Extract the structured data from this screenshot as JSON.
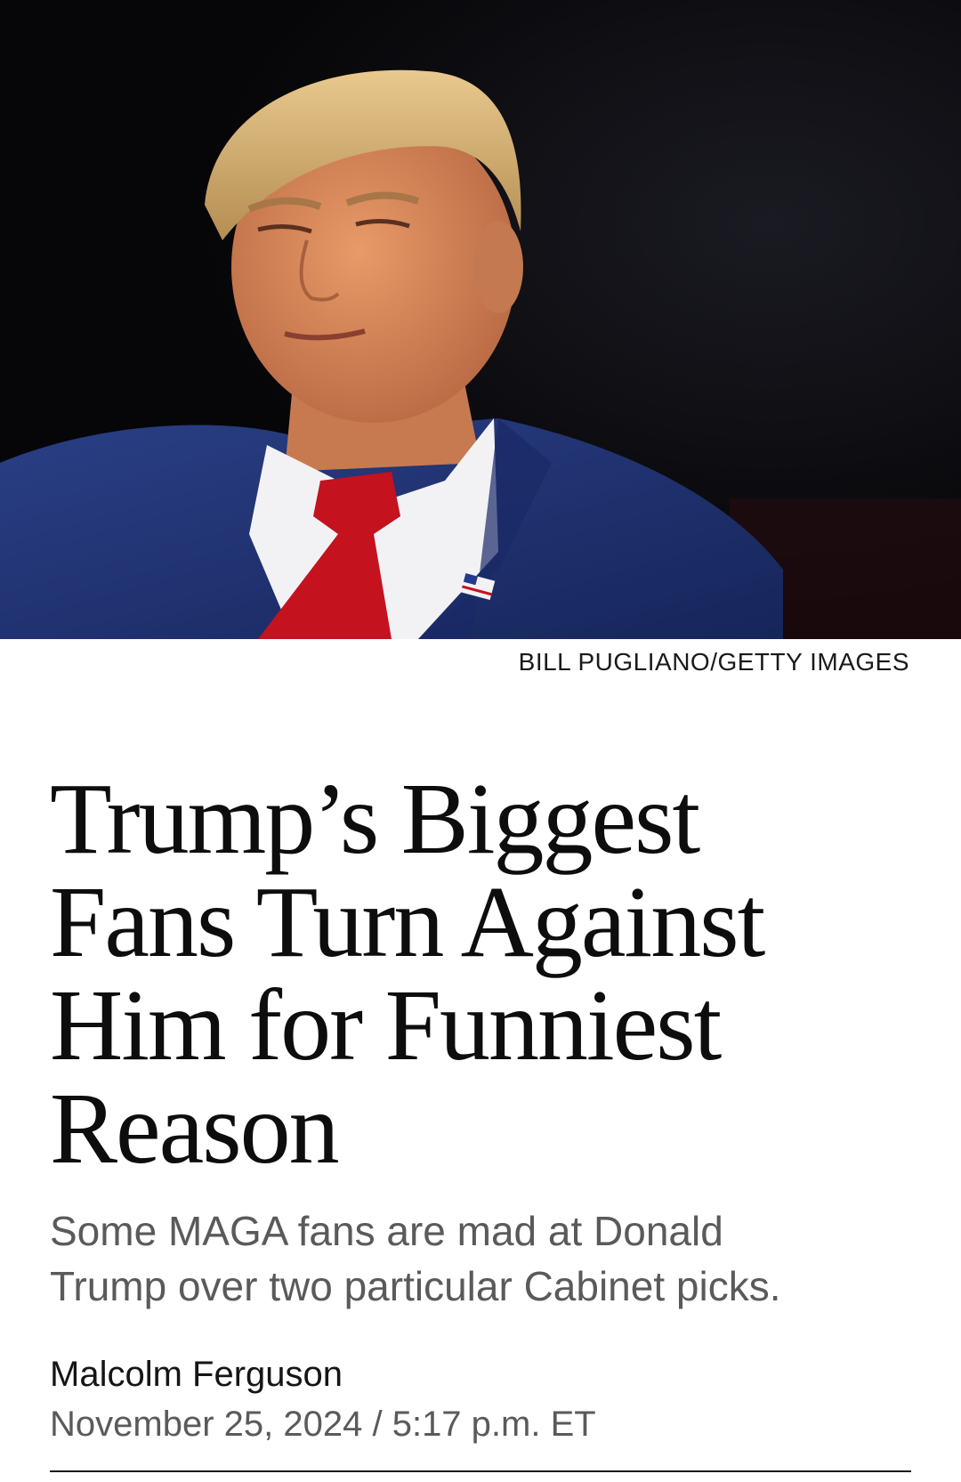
{
  "article": {
    "photo_credit": "BILL PUGLIANO/GETTY IMAGES",
    "headline_lines": [
      "Trump’s Biggest",
      "Fans Turn Against",
      "Him for Funniest",
      "Reason"
    ],
    "dek_lines": [
      "Some MAGA fans are mad at Donald",
      "Trump over two particular Cabinet picks."
    ],
    "author": "Malcolm Ferguson",
    "date": "November 25, 2024",
    "date_separator": "/",
    "time": "5:17 p.m. ET"
  },
  "hero_image": {
    "subject": "portrait-photo",
    "colors": {
      "background": "#0b0b10",
      "suit": "#1f3372",
      "tie": "#c4121f",
      "shirt": "#f2f2f4",
      "skin": "#d98a5c",
      "hair": "#d8b47a"
    }
  }
}
